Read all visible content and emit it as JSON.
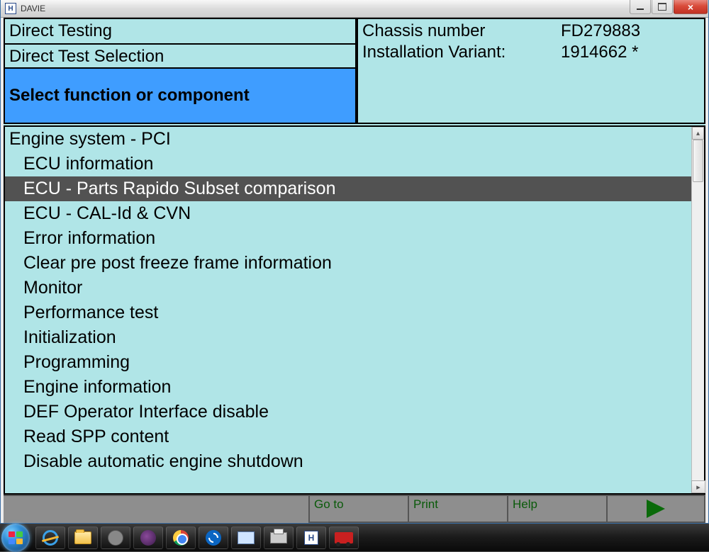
{
  "window": {
    "title": "DAVIE"
  },
  "header": {
    "line1": "Direct Testing",
    "line2": "Direct Test Selection",
    "prompt": "Select function or component"
  },
  "info": {
    "chassis_label": "Chassis number",
    "chassis_value": "FD279883",
    "variant_label": "Installation Variant:",
    "variant_value": "1914662 *"
  },
  "tree": {
    "root": "Engine system - PCI",
    "items": [
      "ECU information",
      "ECU - Parts Rapido Subset comparison",
      "ECU - CAL-Id & CVN",
      "Error information",
      "Clear pre post freeze frame information",
      "Monitor",
      "Performance test",
      "Initialization",
      "Programming",
      "Engine information",
      "DEF Operator Interface disable",
      "Read SPP content",
      "Disable automatic engine shutdown"
    ],
    "selected_index": 1
  },
  "footer": {
    "goto": "Go to",
    "print": "Print",
    "help": "Help"
  }
}
